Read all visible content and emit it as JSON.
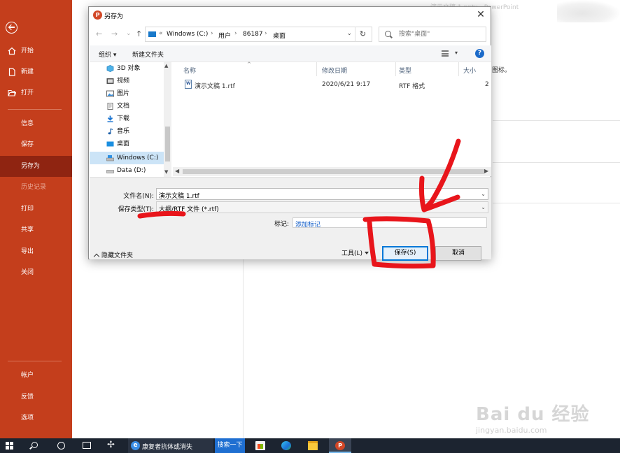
{
  "app": {
    "window_title_faint": "演示文稿 1.pptx  -  PowerPoint",
    "info_hint_text": "图标。"
  },
  "backstage": {
    "back_label": "back",
    "menu": [
      {
        "label": "开始",
        "icon": "home-icon",
        "state": "normal"
      },
      {
        "label": "新建",
        "icon": "new-document-icon",
        "state": "normal"
      },
      {
        "label": "打开",
        "icon": "open-folder-icon",
        "state": "normal"
      },
      {
        "label": "信息",
        "state": "normal"
      },
      {
        "label": "保存",
        "state": "normal"
      },
      {
        "label": "另存为",
        "state": "active"
      },
      {
        "label": "历史记录",
        "state": "disabled"
      },
      {
        "label": "打印",
        "state": "normal"
      },
      {
        "label": "共享",
        "state": "normal"
      },
      {
        "label": "导出",
        "state": "normal"
      },
      {
        "label": "关闭",
        "state": "normal"
      }
    ],
    "bottom_menu": [
      {
        "label": "帐户"
      },
      {
        "label": "反馈"
      },
      {
        "label": "选项"
      }
    ],
    "colors": {
      "sidebar": "#c43e1c",
      "active": "#8f2411"
    }
  },
  "dialog": {
    "title": "另存为",
    "close_glyph": "✕",
    "nav": {
      "back": "←",
      "forward": "→",
      "recent": "⌄",
      "up": "↑"
    },
    "address": {
      "prefix": "«",
      "segments": [
        "Windows (C:)",
        "用户",
        "86187",
        "桌面"
      ],
      "separator": "›",
      "dropdown": "⌄",
      "refresh": "↻"
    },
    "search_placeholder": "搜索\"桌面\"",
    "commands": {
      "organize": "组织 ▾",
      "new_folder": "新建文件夹",
      "view_dropdown": "▾",
      "help": "?"
    },
    "tree": [
      {
        "label": "3D 对象",
        "icon": "3d-objects-icon"
      },
      {
        "label": "视频",
        "icon": "video-icon"
      },
      {
        "label": "图片",
        "icon": "picture-icon"
      },
      {
        "label": "文档",
        "icon": "document-icon"
      },
      {
        "label": "下载",
        "icon": "download-icon"
      },
      {
        "label": "音乐",
        "icon": "music-icon"
      },
      {
        "label": "桌面",
        "icon": "desktop-icon"
      },
      {
        "label": "Windows (C:)",
        "icon": "drive-icon",
        "selected": true
      },
      {
        "label": "Data (D:)",
        "icon": "drive-icon"
      }
    ],
    "columns": [
      "名称",
      "修改日期",
      "类型",
      "大小"
    ],
    "files": [
      {
        "name": "演示文稿 1.rtf",
        "modified": "2020/6/21 9:17",
        "type": "RTF 格式",
        "size": "2"
      }
    ],
    "filename_label": "文件名(N):",
    "filename_value": "演示文稿 1.rtf",
    "filetype_label": "保存类型(T):",
    "filetype_value": "大纲/RTF 文件 (*.rtf)",
    "tags_label": "标记:",
    "tags_value": "添加标记",
    "hide_folders": "隐藏文件夹",
    "tools": "工具(L)",
    "save": "保存(S)",
    "cancel": "取消"
  },
  "taskbar": {
    "news_text": "康复者抗体或消失",
    "search_button": "搜索一下",
    "apps": [
      "start-icon",
      "search-icon",
      "cortana-icon",
      "task-view-icon",
      "fan-icon",
      "edge-news-icon",
      "store-icon",
      "edge-icon",
      "file-explorer-icon",
      "powerpoint-icon"
    ],
    "ppt_glyph": "P"
  },
  "watermark": {
    "main": "Bai du 经验",
    "sub": "jingyan.baidu.com"
  },
  "annotations": {
    "color": "#e8151b"
  }
}
